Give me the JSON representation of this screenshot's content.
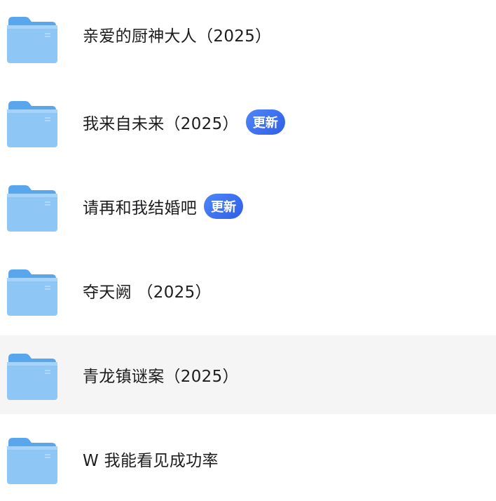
{
  "folders": [
    {
      "name": " 亲爱的厨神大人（2025）",
      "badge": ""
    },
    {
      "name": "我来自未来（2025）",
      "badge": "更新"
    },
    {
      "name": "请再和我结婚吧",
      "badge": "更新"
    },
    {
      "name": "夺天阙 （2025）",
      "badge": ""
    },
    {
      "name": "青龙镇谜案（2025）",
      "badge": ""
    },
    {
      "name": "W 我能看见成功率",
      "badge": ""
    }
  ],
  "hovered_row": 4,
  "colors": {
    "folder_front": "#8ec6f6",
    "folder_back": "#5aa6ec",
    "badge": "#3b6ef0",
    "hover_bg": "#f5f5f6"
  },
  "icons": {
    "folder": "folder-icon"
  }
}
